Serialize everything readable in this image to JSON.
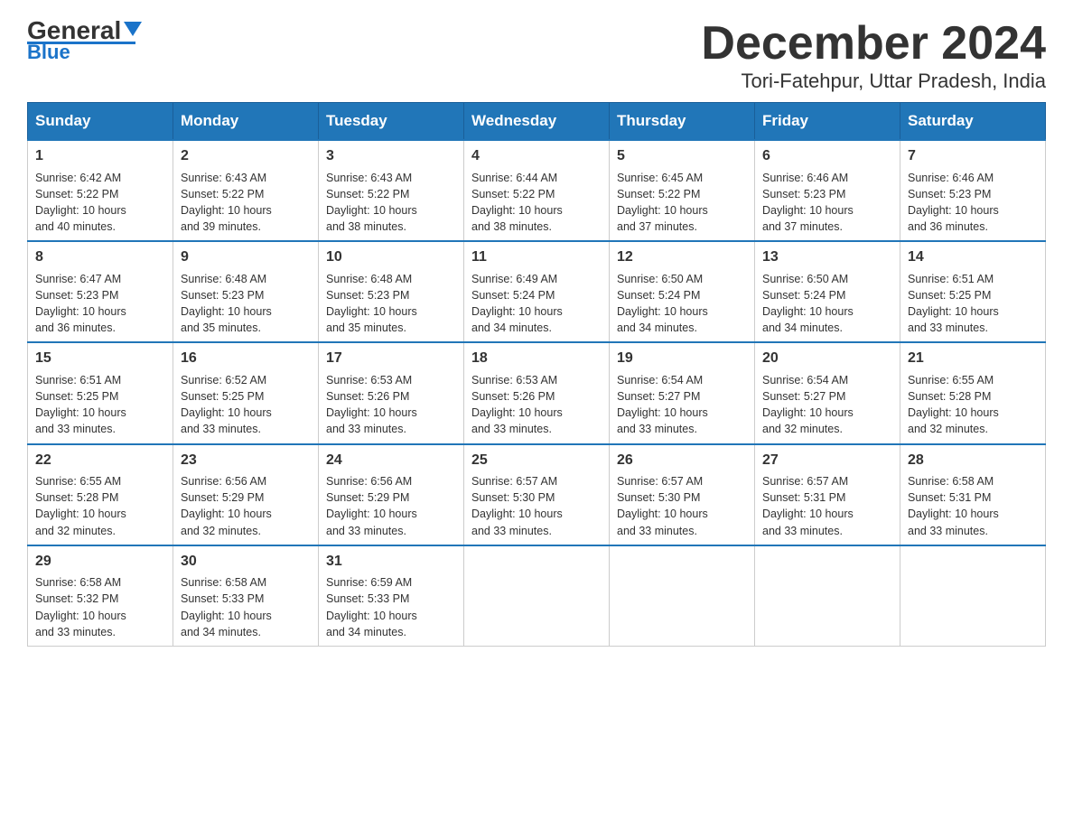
{
  "header": {
    "logo": {
      "text_general": "General",
      "text_blue": "Blue"
    },
    "title": "December 2024",
    "location": "Tori-Fatehpur, Uttar Pradesh, India"
  },
  "calendar": {
    "days_of_week": [
      "Sunday",
      "Monday",
      "Tuesday",
      "Wednesday",
      "Thursday",
      "Friday",
      "Saturday"
    ],
    "weeks": [
      [
        {
          "day": "1",
          "sunrise": "6:42 AM",
          "sunset": "5:22 PM",
          "daylight": "10 hours and 40 minutes."
        },
        {
          "day": "2",
          "sunrise": "6:43 AM",
          "sunset": "5:22 PM",
          "daylight": "10 hours and 39 minutes."
        },
        {
          "day": "3",
          "sunrise": "6:43 AM",
          "sunset": "5:22 PM",
          "daylight": "10 hours and 38 minutes."
        },
        {
          "day": "4",
          "sunrise": "6:44 AM",
          "sunset": "5:22 PM",
          "daylight": "10 hours and 38 minutes."
        },
        {
          "day": "5",
          "sunrise": "6:45 AM",
          "sunset": "5:22 PM",
          "daylight": "10 hours and 37 minutes."
        },
        {
          "day": "6",
          "sunrise": "6:46 AM",
          "sunset": "5:23 PM",
          "daylight": "10 hours and 37 minutes."
        },
        {
          "day": "7",
          "sunrise": "6:46 AM",
          "sunset": "5:23 PM",
          "daylight": "10 hours and 36 minutes."
        }
      ],
      [
        {
          "day": "8",
          "sunrise": "6:47 AM",
          "sunset": "5:23 PM",
          "daylight": "10 hours and 36 minutes."
        },
        {
          "day": "9",
          "sunrise": "6:48 AM",
          "sunset": "5:23 PM",
          "daylight": "10 hours and 35 minutes."
        },
        {
          "day": "10",
          "sunrise": "6:48 AM",
          "sunset": "5:23 PM",
          "daylight": "10 hours and 35 minutes."
        },
        {
          "day": "11",
          "sunrise": "6:49 AM",
          "sunset": "5:24 PM",
          "daylight": "10 hours and 34 minutes."
        },
        {
          "day": "12",
          "sunrise": "6:50 AM",
          "sunset": "5:24 PM",
          "daylight": "10 hours and 34 minutes."
        },
        {
          "day": "13",
          "sunrise": "6:50 AM",
          "sunset": "5:24 PM",
          "daylight": "10 hours and 34 minutes."
        },
        {
          "day": "14",
          "sunrise": "6:51 AM",
          "sunset": "5:25 PM",
          "daylight": "10 hours and 33 minutes."
        }
      ],
      [
        {
          "day": "15",
          "sunrise": "6:51 AM",
          "sunset": "5:25 PM",
          "daylight": "10 hours and 33 minutes."
        },
        {
          "day": "16",
          "sunrise": "6:52 AM",
          "sunset": "5:25 PM",
          "daylight": "10 hours and 33 minutes."
        },
        {
          "day": "17",
          "sunrise": "6:53 AM",
          "sunset": "5:26 PM",
          "daylight": "10 hours and 33 minutes."
        },
        {
          "day": "18",
          "sunrise": "6:53 AM",
          "sunset": "5:26 PM",
          "daylight": "10 hours and 33 minutes."
        },
        {
          "day": "19",
          "sunrise": "6:54 AM",
          "sunset": "5:27 PM",
          "daylight": "10 hours and 33 minutes."
        },
        {
          "day": "20",
          "sunrise": "6:54 AM",
          "sunset": "5:27 PM",
          "daylight": "10 hours and 32 minutes."
        },
        {
          "day": "21",
          "sunrise": "6:55 AM",
          "sunset": "5:28 PM",
          "daylight": "10 hours and 32 minutes."
        }
      ],
      [
        {
          "day": "22",
          "sunrise": "6:55 AM",
          "sunset": "5:28 PM",
          "daylight": "10 hours and 32 minutes."
        },
        {
          "day": "23",
          "sunrise": "6:56 AM",
          "sunset": "5:29 PM",
          "daylight": "10 hours and 32 minutes."
        },
        {
          "day": "24",
          "sunrise": "6:56 AM",
          "sunset": "5:29 PM",
          "daylight": "10 hours and 33 minutes."
        },
        {
          "day": "25",
          "sunrise": "6:57 AM",
          "sunset": "5:30 PM",
          "daylight": "10 hours and 33 minutes."
        },
        {
          "day": "26",
          "sunrise": "6:57 AM",
          "sunset": "5:30 PM",
          "daylight": "10 hours and 33 minutes."
        },
        {
          "day": "27",
          "sunrise": "6:57 AM",
          "sunset": "5:31 PM",
          "daylight": "10 hours and 33 minutes."
        },
        {
          "day": "28",
          "sunrise": "6:58 AM",
          "sunset": "5:31 PM",
          "daylight": "10 hours and 33 minutes."
        }
      ],
      [
        {
          "day": "29",
          "sunrise": "6:58 AM",
          "sunset": "5:32 PM",
          "daylight": "10 hours and 33 minutes."
        },
        {
          "day": "30",
          "sunrise": "6:58 AM",
          "sunset": "5:33 PM",
          "daylight": "10 hours and 34 minutes."
        },
        {
          "day": "31",
          "sunrise": "6:59 AM",
          "sunset": "5:33 PM",
          "daylight": "10 hours and 34 minutes."
        },
        null,
        null,
        null,
        null
      ]
    ],
    "labels": {
      "sunrise": "Sunrise:",
      "sunset": "Sunset:",
      "daylight": "Daylight:"
    }
  }
}
